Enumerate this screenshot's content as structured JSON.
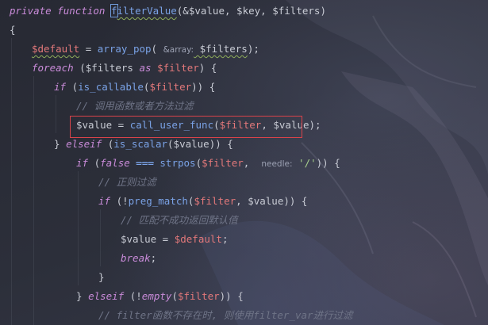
{
  "editor": {
    "lines": [
      {
        "tokens": [
          {
            "t": "private",
            "c": "kw"
          },
          {
            "t": " ",
            "c": "plain"
          },
          {
            "t": "function",
            "c": "kw"
          },
          {
            "t": " ",
            "c": "plain"
          },
          {
            "t": "f",
            "c": "fn cursor-box"
          },
          {
            "t": "ilterValue",
            "c": "fn squiggle"
          },
          {
            "t": "(&",
            "c": "plain"
          },
          {
            "t": "$value",
            "c": "plain"
          },
          {
            "t": ", ",
            "c": "plain"
          },
          {
            "t": "$key",
            "c": "plain"
          },
          {
            "t": ", ",
            "c": "plain"
          },
          {
            "t": "$filters",
            "c": "plain"
          },
          {
            "t": ")",
            "c": "plain"
          }
        ]
      },
      {
        "tokens": [
          {
            "t": "{",
            "c": "plain"
          }
        ]
      },
      {
        "tokens": [
          {
            "t": "$default",
            "c": "var squiggle"
          },
          {
            "t": " = ",
            "c": "plain"
          },
          {
            "t": "array_pop",
            "c": "fn"
          },
          {
            "t": "( ",
            "c": "plain"
          },
          {
            "t": "&array:",
            "c": "hint"
          },
          {
            "t": " $filters",
            "c": "plain squiggle"
          },
          {
            "t": ");",
            "c": "plain"
          }
        ]
      },
      {
        "tokens": [
          {
            "t": "foreach",
            "c": "kw"
          },
          {
            "t": " (",
            "c": "plain"
          },
          {
            "t": "$filters",
            "c": "plain"
          },
          {
            "t": " ",
            "c": "plain"
          },
          {
            "t": "as",
            "c": "kw"
          },
          {
            "t": " ",
            "c": "plain"
          },
          {
            "t": "$filter",
            "c": "var"
          },
          {
            "t": ") {",
            "c": "plain"
          }
        ]
      },
      {
        "tokens": [
          {
            "t": "if",
            "c": "kw"
          },
          {
            "t": " (",
            "c": "plain"
          },
          {
            "t": "is_callable",
            "c": "fn"
          },
          {
            "t": "(",
            "c": "plain"
          },
          {
            "t": "$filter",
            "c": "var"
          },
          {
            "t": ")) {",
            "c": "plain"
          }
        ]
      },
      {
        "tokens": [
          {
            "t": "// 调用函数或者方法过滤",
            "c": "cmt"
          }
        ]
      },
      {
        "tokens": [
          {
            "t": "$value",
            "c": "plain"
          },
          {
            "t": " = ",
            "c": "plain"
          },
          {
            "t": "call_user_func",
            "c": "fn"
          },
          {
            "t": "(",
            "c": "plain"
          },
          {
            "t": "$filter",
            "c": "var"
          },
          {
            "t": ", ",
            "c": "plain"
          },
          {
            "t": "$value",
            "c": "plain"
          },
          {
            "t": ");",
            "c": "plain"
          }
        ]
      },
      {
        "tokens": [
          {
            "t": "} ",
            "c": "plain"
          },
          {
            "t": "elseif",
            "c": "kw"
          },
          {
            "t": " (",
            "c": "plain"
          },
          {
            "t": "is_scalar",
            "c": "fn"
          },
          {
            "t": "(",
            "c": "plain"
          },
          {
            "t": "$value",
            "c": "plain"
          },
          {
            "t": ")) {",
            "c": "plain"
          }
        ]
      },
      {
        "tokens": [
          {
            "t": "if",
            "c": "kw"
          },
          {
            "t": " (",
            "c": "plain"
          },
          {
            "t": "false",
            "c": "kw"
          },
          {
            "t": " ",
            "c": "plain"
          },
          {
            "t": "===",
            "c": "fn strike"
          },
          {
            "t": " ",
            "c": "plain"
          },
          {
            "t": "strpos",
            "c": "fn"
          },
          {
            "t": "(",
            "c": "plain"
          },
          {
            "t": "$filter",
            "c": "var"
          },
          {
            "t": ",  ",
            "c": "plain"
          },
          {
            "t": "needle:",
            "c": "hint"
          },
          {
            "t": " ",
            "c": "plain"
          },
          {
            "t": "'/'",
            "c": "str"
          },
          {
            "t": ")) {",
            "c": "plain"
          }
        ]
      },
      {
        "tokens": [
          {
            "t": "// 正则过滤",
            "c": "cmt"
          }
        ]
      },
      {
        "tokens": [
          {
            "t": "if",
            "c": "kw"
          },
          {
            "t": " (!",
            "c": "plain"
          },
          {
            "t": "preg_match",
            "c": "fn"
          },
          {
            "t": "(",
            "c": "plain"
          },
          {
            "t": "$filter",
            "c": "var"
          },
          {
            "t": ", ",
            "c": "plain"
          },
          {
            "t": "$value",
            "c": "plain"
          },
          {
            "t": ")) {",
            "c": "plain"
          }
        ]
      },
      {
        "tokens": [
          {
            "t": "// 匹配不成功返回默认值",
            "c": "cmt"
          }
        ]
      },
      {
        "tokens": [
          {
            "t": "$value",
            "c": "plain"
          },
          {
            "t": " = ",
            "c": "plain"
          },
          {
            "t": "$default",
            "c": "var"
          },
          {
            "t": ";",
            "c": "plain"
          }
        ]
      },
      {
        "tokens": [
          {
            "t": "break",
            "c": "kw"
          },
          {
            "t": ";",
            "c": "plain"
          }
        ]
      },
      {
        "tokens": [
          {
            "t": "}",
            "c": "plain"
          }
        ]
      },
      {
        "tokens": [
          {
            "t": "} ",
            "c": "plain"
          },
          {
            "t": "elseif",
            "c": "kw"
          },
          {
            "t": " (!",
            "c": "plain"
          },
          {
            "t": "empty",
            "c": "kw"
          },
          {
            "t": "(",
            "c": "plain"
          },
          {
            "t": "$filter",
            "c": "var"
          },
          {
            "t": ")) {",
            "c": "plain"
          }
        ]
      },
      {
        "tokens": [
          {
            "t": "// filter函数不存在时, 则使用filter_var进行过滤",
            "c": "cmt"
          }
        ]
      }
    ]
  }
}
